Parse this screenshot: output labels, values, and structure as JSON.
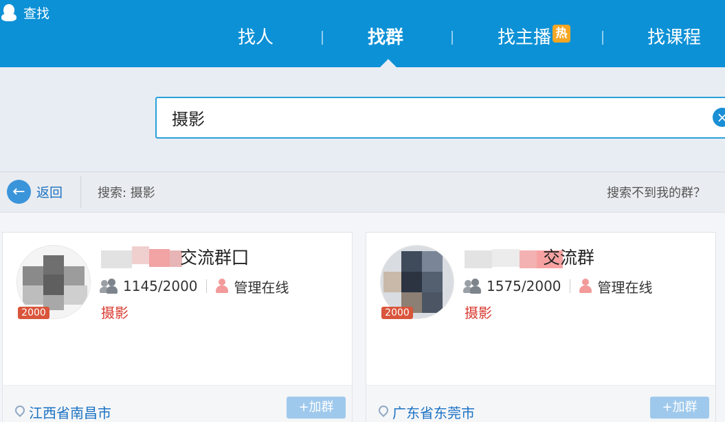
{
  "window": {
    "title": "查找"
  },
  "tabs": [
    {
      "label": "找人"
    },
    {
      "label": "找群"
    },
    {
      "label": "找主播",
      "badge": "热"
    },
    {
      "label": "找课程"
    }
  ],
  "active_tab": "找群",
  "search": {
    "value": "摄影"
  },
  "result_bar": {
    "back_label": "返回",
    "search_term": "搜索: 摄影",
    "cant_find": "搜索不到我的群？"
  },
  "results": [
    {
      "name_suffix": "交流群囗",
      "members": "1145/2000",
      "admin_status": "管理在线",
      "tag": "摄影",
      "size_badge": "2000",
      "location": "江西省南昌市",
      "join_label": "+加群"
    },
    {
      "name_suffix": "交流群",
      "members": "1575/2000",
      "admin_status": "管理在线",
      "tag": "摄影",
      "size_badge": "2000",
      "location": "广东省东莞市",
      "join_label": "+加群"
    }
  ],
  "colors": {
    "header": "#0d91d6",
    "accent_blue": "#1a72c4",
    "tag_red": "#d93a30",
    "badge_orange": "#f5a623"
  }
}
